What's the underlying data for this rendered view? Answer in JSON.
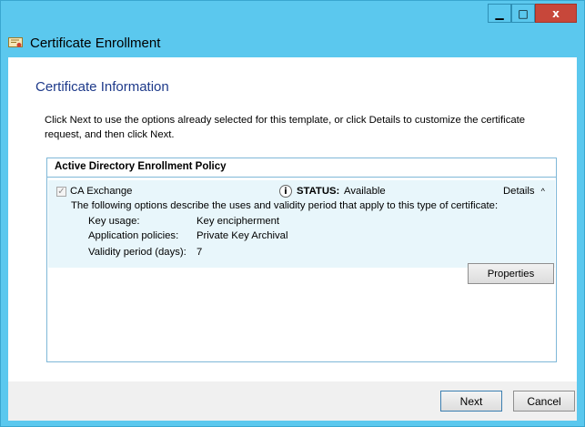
{
  "window": {
    "title": "Certificate Enrollment",
    "controls": {
      "minimize": "▁",
      "maximize": "□",
      "close": "x"
    }
  },
  "page": {
    "heading": "Certificate Information",
    "intro": "Click Next to use the options already selected for this template, or click Details to customize the certificate request, and then click Next."
  },
  "policy": {
    "title": "Active Directory Enrollment Policy",
    "template": {
      "name": "CA Exchange",
      "checked": true,
      "status_label": "STATUS:",
      "status_value": "Available",
      "details_label": "Details",
      "description": "The following options describe the uses and validity period that apply to this type of certificate:",
      "fields": [
        {
          "label": "Key usage:",
          "value": "Key encipherment"
        },
        {
          "label": "Application policies:",
          "value": "Private Key Archival"
        },
        {
          "label": "Validity period (days):",
          "value": "7"
        }
      ],
      "properties_button": "Properties"
    }
  },
  "buttons": {
    "next": "Next",
    "cancel": "Cancel"
  },
  "colors": {
    "frame": "#5bc8ee",
    "close": "#c7473a",
    "heading": "#1e3a8a",
    "panel": "#e8f6fb"
  }
}
